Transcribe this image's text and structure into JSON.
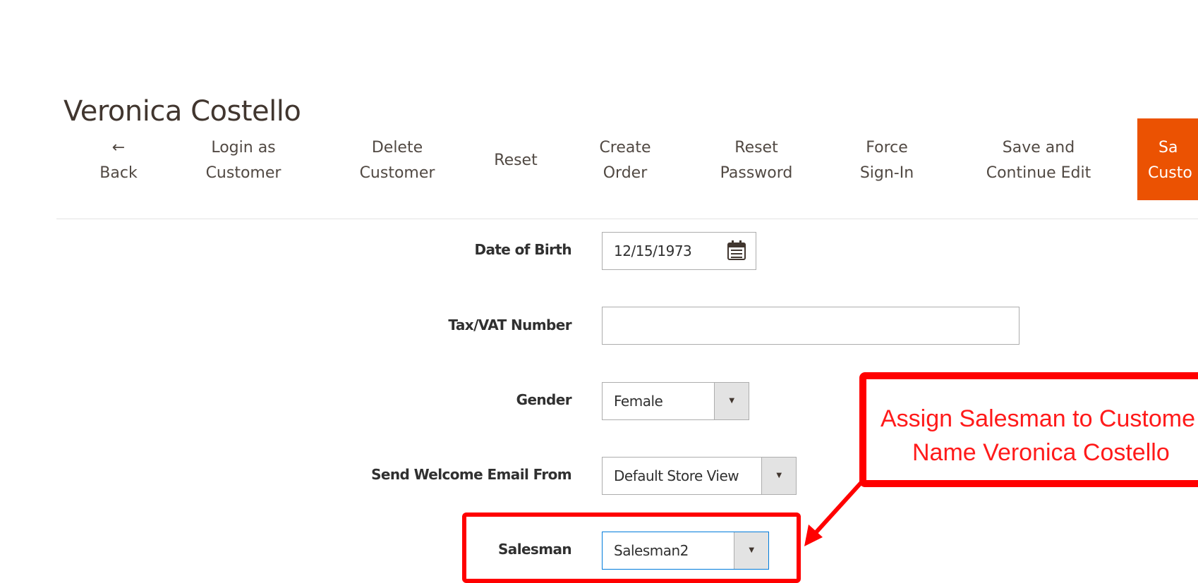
{
  "page": {
    "title": "Veronica Costello"
  },
  "toolbar": {
    "back": {
      "icon": "←",
      "label": "Back"
    },
    "login_as_customer": {
      "line1": "Login as",
      "line2": "Customer"
    },
    "delete_customer": {
      "line1": "Delete",
      "line2": "Customer"
    },
    "reset": {
      "label": "Reset"
    },
    "create_order": {
      "line1": "Create",
      "line2": "Order"
    },
    "reset_password": {
      "line1": "Reset",
      "line2": "Password"
    },
    "force_sign_in": {
      "line1": "Force",
      "line2": "Sign-In"
    },
    "save_continue": {
      "line1": "Save and",
      "line2": "Continue Edit"
    },
    "save_customer": {
      "line1": "Sa",
      "line2": "Custo"
    }
  },
  "form": {
    "date_of_birth": {
      "label": "Date of Birth",
      "value": "12/15/1973"
    },
    "tax_vat": {
      "label": "Tax/VAT Number",
      "value": ""
    },
    "gender": {
      "label": "Gender",
      "value": "Female"
    },
    "welcome_email": {
      "label": "Send Welcome Email From",
      "value": "Default Store View"
    },
    "salesman": {
      "label": "Salesman",
      "value": "Salesman2"
    }
  },
  "annotation": {
    "line1": "Assign Salesman to Custome",
    "line2": "Name Veronica Costello",
    "color": "#ff0000"
  },
  "colors": {
    "primary_button": "#eb5202",
    "annotation": "#ff0000"
  }
}
